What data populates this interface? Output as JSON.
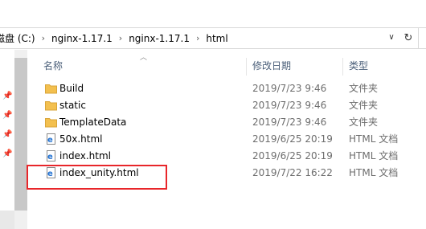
{
  "address": {
    "crumbs": [
      "磁盘 (C:)",
      "nginx-1.17.1",
      "nginx-1.17.1",
      "html"
    ],
    "separator": "›",
    "chevron": "∨",
    "refresh": "↻"
  },
  "columns": {
    "name": "名称",
    "date": "修改日期",
    "type": "类型"
  },
  "files": [
    {
      "name": "Build",
      "date": "2019/7/23 9:46",
      "type": "文件夹",
      "icon": "folder-icon"
    },
    {
      "name": "static",
      "date": "2019/7/23 9:46",
      "type": "文件夹",
      "icon": "folder-icon"
    },
    {
      "name": "TemplateData",
      "date": "2019/7/23 9:46",
      "type": "文件夹",
      "icon": "folder-icon"
    },
    {
      "name": "50x.html",
      "date": "2019/6/25 20:19",
      "type": "HTML 文档",
      "icon": "html-file-icon"
    },
    {
      "name": "index.html",
      "date": "2019/6/25 20:19",
      "type": "HTML 文档",
      "icon": "html-file-icon"
    },
    {
      "name": "index_unity.html",
      "date": "2019/7/22 16:22",
      "type": "HTML 文档",
      "icon": "html-file-icon"
    }
  ],
  "colors": {
    "highlight": "#e8262a",
    "folder": "#f3c04f",
    "header_text": "#4c607a"
  }
}
